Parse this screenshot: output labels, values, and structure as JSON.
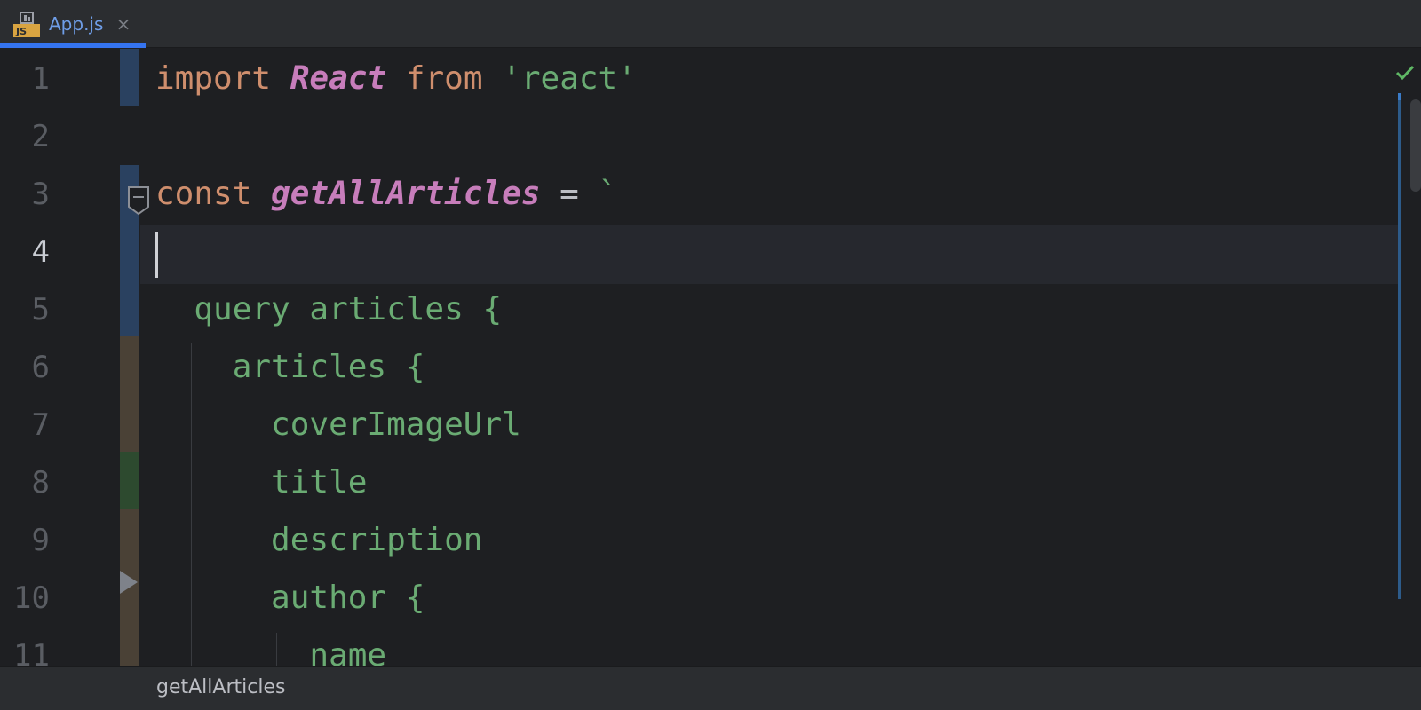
{
  "tab": {
    "icon": "js-file-icon",
    "icon_label": "JS",
    "label": "App.js",
    "close": "×"
  },
  "editor": {
    "current_line": 4,
    "line_numbers": [
      "1",
      "2",
      "3",
      "4",
      "5",
      "6",
      "7",
      "8",
      "9",
      "10",
      "11"
    ],
    "lines": [
      [
        {
          "t": "import",
          "c": "kw"
        },
        {
          "t": " ",
          "c": "op"
        },
        {
          "t": "React",
          "c": "ident"
        },
        {
          "t": " ",
          "c": "op"
        },
        {
          "t": "from",
          "c": "kw"
        },
        {
          "t": " ",
          "c": "op"
        },
        {
          "t": "'react'",
          "c": "str"
        }
      ],
      [],
      [
        {
          "t": "const",
          "c": "kw"
        },
        {
          "t": " ",
          "c": "op"
        },
        {
          "t": "getAllArticles",
          "c": "ident"
        },
        {
          "t": " = ",
          "c": "op"
        },
        {
          "t": "`",
          "c": "str"
        }
      ],
      [],
      [
        {
          "t": "  query articles {",
          "c": "gql"
        }
      ],
      [
        {
          "t": "    articles {",
          "c": "gql"
        }
      ],
      [
        {
          "t": "      coverImageUrl",
          "c": "gql"
        }
      ],
      [
        {
          "t": "      title",
          "c": "gql"
        }
      ],
      [
        {
          "t": "      description",
          "c": "gql"
        }
      ],
      [
        {
          "t": "      author {",
          "c": "gql"
        }
      ],
      [
        {
          "t": "        name",
          "c": "gql"
        }
      ]
    ]
  },
  "inspection": {
    "icon": "checkmark-icon",
    "color": "#5fb865"
  },
  "breadcrumb": {
    "items": [
      "getAllArticles"
    ]
  },
  "colors": {
    "keyword": "#cf8e6d",
    "identifier": "#c77dbb",
    "string": "#6aab73",
    "accent": "#3574f0"
  }
}
